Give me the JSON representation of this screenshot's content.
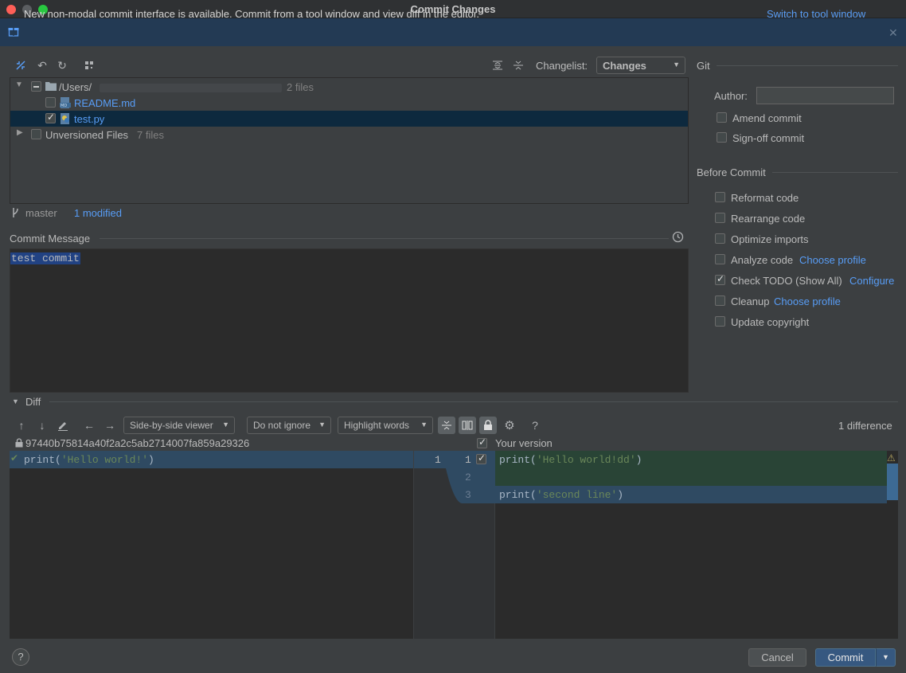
{
  "window": {
    "title": "Commit Changes"
  },
  "banner": {
    "message": "New non-modal commit interface is available. Commit from a tool window and view diff in the editor.",
    "link": "Switch to tool window"
  },
  "toolbar": {
    "changelist_label": "Changelist:",
    "changelist_value": "Changes"
  },
  "tree": {
    "root": {
      "path": "/Users/",
      "count": "2 files"
    },
    "files": [
      {
        "name": "README.md",
        "checked": false
      },
      {
        "name": "test.py",
        "checked": true
      }
    ],
    "unversioned": {
      "label": "Unversioned Files",
      "count": "7 files"
    }
  },
  "status": {
    "branch": "master",
    "modified": "1 modified"
  },
  "commit_message": {
    "label": "Commit Message",
    "text": "test commit"
  },
  "git": {
    "heading": "Git",
    "author_label": "Author:",
    "author_value": "",
    "options": [
      {
        "label": "Amend commit",
        "checked": false
      },
      {
        "label": "Sign-off commit",
        "checked": false
      }
    ]
  },
  "before_commit": {
    "heading": "Before Commit",
    "options": [
      {
        "label": "Reformat code",
        "checked": false,
        "link": ""
      },
      {
        "label": "Rearrange code",
        "checked": false,
        "link": ""
      },
      {
        "label": "Optimize imports",
        "checked": false,
        "link": ""
      },
      {
        "label": "Analyze code",
        "checked": false,
        "link": "Choose profile"
      },
      {
        "label": "Check TODO (Show All)",
        "checked": true,
        "link": "Configure"
      },
      {
        "label": "Cleanup",
        "checked": false,
        "link": "Choose profile"
      },
      {
        "label": "Update copyright",
        "checked": false,
        "link": ""
      }
    ]
  },
  "diff": {
    "heading": "Diff",
    "viewer": "Side-by-side viewer",
    "ignore": "Do not ignore",
    "highlight": "Highlight words",
    "differences": "1 difference",
    "left_header": "97440b75814a40f2a2c5ab2714007fa859a29326",
    "right_header": "Your version",
    "left_lines": [
      {
        "fn": "print(",
        "str": "'Hello world!'",
        "end": ")"
      }
    ],
    "left_line_numbers": [
      "1"
    ],
    "right_line_numbers": [
      "1",
      "2",
      "3"
    ],
    "right_lines": [
      {
        "fn": "print(",
        "str": "'Hello world!dd'",
        "end": ")"
      },
      {
        "fn": "",
        "str": "",
        "end": ""
      },
      {
        "fn": "print(",
        "str": "'second line'",
        "end": ")"
      }
    ]
  },
  "footer": {
    "help": "?",
    "cancel": "Cancel",
    "commit": "Commit"
  },
  "colors": {
    "accent": "#589df6",
    "selection": "#0d293e",
    "primary_button": "#365880",
    "added": "#294436",
    "modified": "#2f4a62"
  }
}
